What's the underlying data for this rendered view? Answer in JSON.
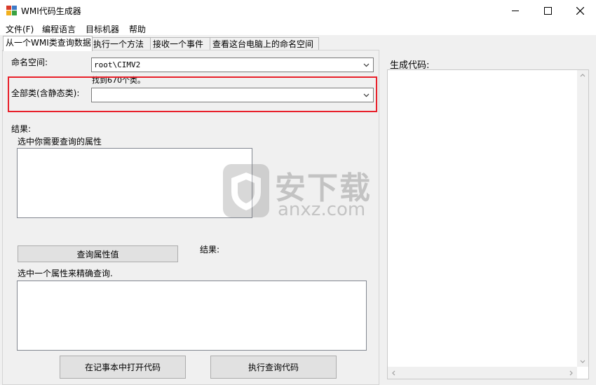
{
  "window": {
    "title": "WMI代码生成器",
    "controls": {
      "minimize": "—",
      "maximize": "☐",
      "close": "✕"
    }
  },
  "menu": [
    "文件(F)",
    "编程语言",
    "目标机器",
    "帮助"
  ],
  "tabs": [
    "从一个WMI类查询数据",
    "执行一个方法",
    "接收一个事件",
    "查看这台电脑上的命名空间"
  ],
  "query_tab": {
    "namespace_label": "命名空间:",
    "namespace_value": "root\\CIMV2",
    "found_text": "找到670个类。",
    "all_classes_label": "全部类(含静态类):",
    "all_classes_value": "",
    "results_label": "结果:",
    "select_props_label": "选中你需要查询的属性",
    "query_values_button": "查询属性值",
    "results_label_2": "结果:",
    "select_one_prop_label": "选中一个属性来精确查询.",
    "open_notepad_button": "在记事本中打开代码",
    "execute_button": "执行查询代码"
  },
  "code_panel": {
    "label": "生成代码:",
    "content": ""
  },
  "watermark": {
    "text": "安下载",
    "subtext": "anxz.com"
  },
  "colors": {
    "highlight": "#e8202a"
  }
}
